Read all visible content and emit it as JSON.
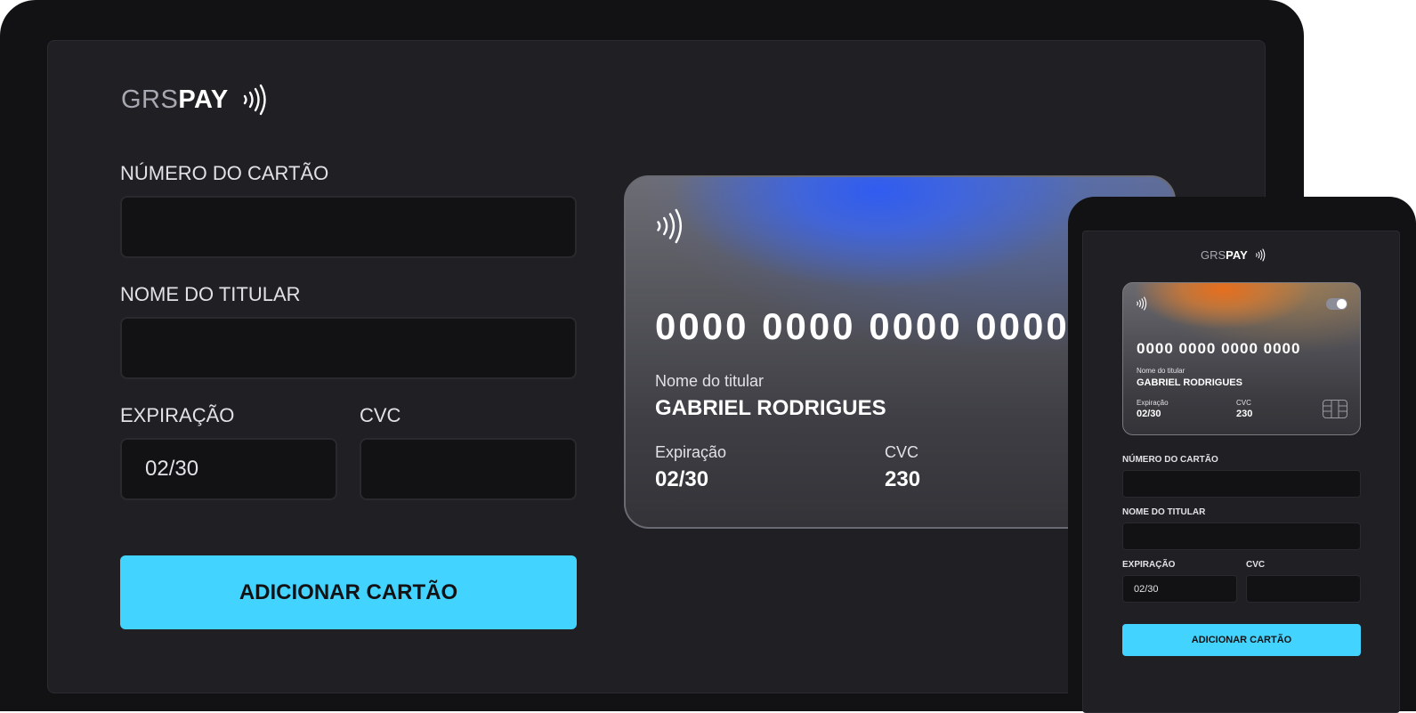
{
  "brand": {
    "part1": "GRS",
    "part2": "PAY",
    "icon": "contactless-icon"
  },
  "colors": {
    "accent": "#43d3ff",
    "background": "#202024",
    "input_bg": "#121214",
    "desktop_card_glow": "#305cf0",
    "mobile_card_glow": "#e66e1e"
  },
  "form": {
    "card_number_label": "NÚMERO DO CARTÃO",
    "card_number_value": "",
    "holder_label": "NOME DO TITULAR",
    "holder_value": "",
    "expiry_label": "EXPIRAÇÃO",
    "expiry_value": "02/30",
    "cvc_label": "CVC",
    "cvc_value": "",
    "submit_label": "ADICIONAR CARTÃO"
  },
  "card_preview": {
    "number": "0000 0000 0000 0000",
    "holder_caption": "Nome do titular",
    "holder_name": "GABRIEL RODRIGUES",
    "expiry_caption": "Expiração",
    "expiry": "02/30",
    "cvc_caption": "CVC",
    "cvc": "230"
  }
}
